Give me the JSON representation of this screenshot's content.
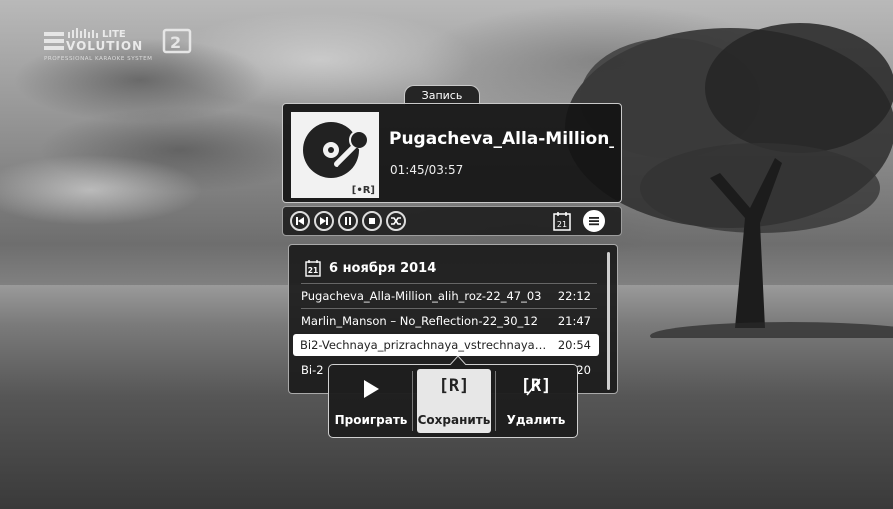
{
  "logo": {
    "word_top": "LITE",
    "word_main": "VOLUTION",
    "subtitle": "PROFESSIONAL KARAOKE SYSTEM"
  },
  "player": {
    "tab_label": "Запись",
    "track_title": "Pugacheva_Alla-Million_al…",
    "track_time": "01:45/03:57",
    "cover_badge": "[•R]",
    "controls": [
      "prev-icon",
      "next-icon",
      "pause-icon",
      "stop-icon",
      "shuffle-icon",
      "calendar-icon",
      "menu-icon"
    ],
    "calendar_day": "21"
  },
  "recordings": {
    "date_label": "6 ноября 2014",
    "calendar_day": "21",
    "items": [
      {
        "name": "Pugacheva_Alla-Million_alih_roz-22_47_03",
        "time": "22:12"
      },
      {
        "name": "Marlin_Manson – No_Reflection-22_30_12",
        "time": "21:47"
      },
      {
        "name": "Bi2-Vechnaya_prizrachnaya_vstrechnaya-…",
        "time": "20:54"
      },
      {
        "name": "Bi-2",
        "time": "20"
      }
    ]
  },
  "context_menu": {
    "play_label": "Проиграть",
    "save_label": "Сохранить",
    "delete_label": "Удалить",
    "save_icon_text": "[R]",
    "delete_icon_text": "[R]"
  }
}
